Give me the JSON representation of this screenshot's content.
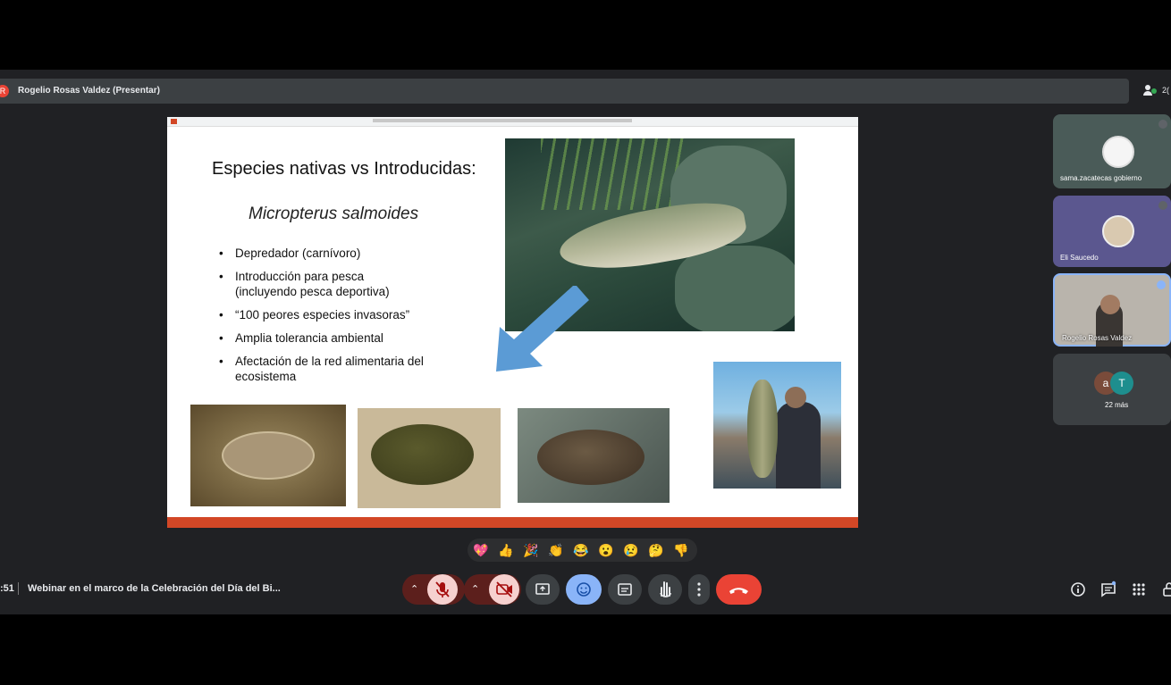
{
  "presenter_bar": {
    "initial": "R",
    "label": "Rogelio Rosas Valdez (Presentar)",
    "participants_count": "2("
  },
  "slide": {
    "title": "Especies nativas vs Introducidas:",
    "species": "Micropterus salmoides",
    "bullets": [
      "Depredador (carnívoro)",
      "Introducción para pesca (incluyendo pesca deportiva)",
      "“100 peores especies invasoras”",
      "Amplia tolerancia ambiental",
      "Afectación de la red alimentaria del ecosistema"
    ]
  },
  "participants": [
    {
      "name": "sama.zacatecas gobierno"
    },
    {
      "name": "Eli Saucedo"
    },
    {
      "name": "Rogelio Rosas Valdez"
    },
    {
      "avatar_a": "a",
      "avatar_t": "T",
      "more": "22 más"
    }
  ],
  "reactions": [
    "💖",
    "👍",
    "🎉",
    "👏",
    "😂",
    "😮",
    "😢",
    "🤔",
    "👎"
  ],
  "bottom_bar": {
    "time": ":51",
    "meeting_title": "Webinar en el marco de la Celebración del Día del Bi..."
  },
  "colors": {
    "end_call": "#ea4335",
    "muted_button": "#f6d1cf",
    "active_button": "#8ab4f8",
    "dark_button": "#3c4043",
    "slide_accent": "#d24726",
    "arrow": "#5b9bd5"
  }
}
